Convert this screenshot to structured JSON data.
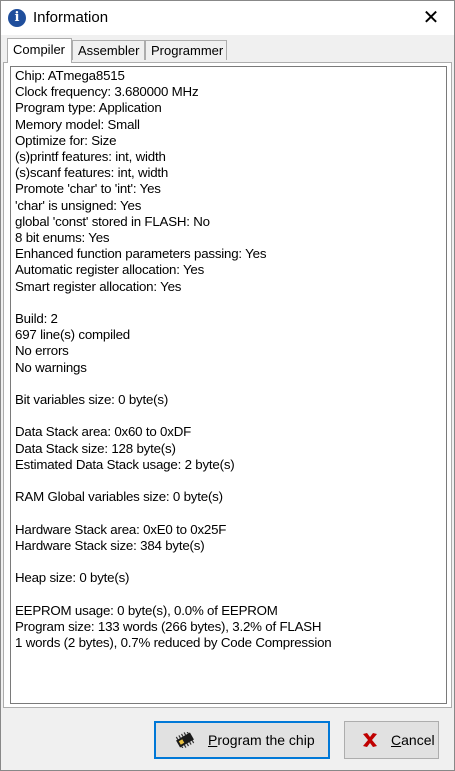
{
  "window": {
    "title": "Information",
    "icon": "info-icon",
    "close_symbol": "✕"
  },
  "tabs": [
    {
      "label": "Compiler",
      "active": true
    },
    {
      "label": "Assembler",
      "active": false
    },
    {
      "label": "Programmer",
      "active": false
    }
  ],
  "info_lines": [
    "Chip: ATmega8515",
    "Clock frequency: 3.680000 MHz",
    "Program type: Application",
    "Memory model: Small",
    "Optimize for: Size",
    "(s)printf features: int, width",
    "(s)scanf features: int, width",
    "Promote 'char' to 'int': Yes",
    "'char' is unsigned: Yes",
    "global 'const' stored in FLASH: No",
    "8 bit enums: Yes",
    "Enhanced function parameters passing: Yes",
    "Automatic register allocation: Yes",
    "Smart register allocation: Yes",
    "",
    "Build: 2",
    "697 line(s) compiled",
    "No errors",
    "No warnings",
    "",
    "Bit variables size: 0 byte(s)",
    "",
    "Data Stack area: 0x60 to 0xDF",
    "Data Stack size: 128 byte(s)",
    "Estimated Data Stack usage: 2 byte(s)",
    "",
    "RAM Global variables size: 0 byte(s)",
    "",
    "Hardware Stack area: 0xE0 to 0x25F",
    "Hardware Stack size: 384 byte(s)",
    "",
    "Heap size: 0 byte(s)",
    "",
    "EEPROM usage: 0 byte(s), 0.0% of EEPROM",
    "Program size: 133 words (266 bytes), 3.2% of FLASH",
    "1 words (2 bytes), 0.7% reduced by Code Compression"
  ],
  "buttons": {
    "program": {
      "mnemonic": "P",
      "rest": "rogram the chip",
      "icon": "chip-icon"
    },
    "cancel": {
      "mnemonic": "C",
      "rest": "ancel",
      "icon": "x-icon",
      "icon_color": "#c00000"
    }
  },
  "colors": {
    "default_button_border": "#0078d7",
    "title_icon_bg": "#1f4e9c"
  }
}
